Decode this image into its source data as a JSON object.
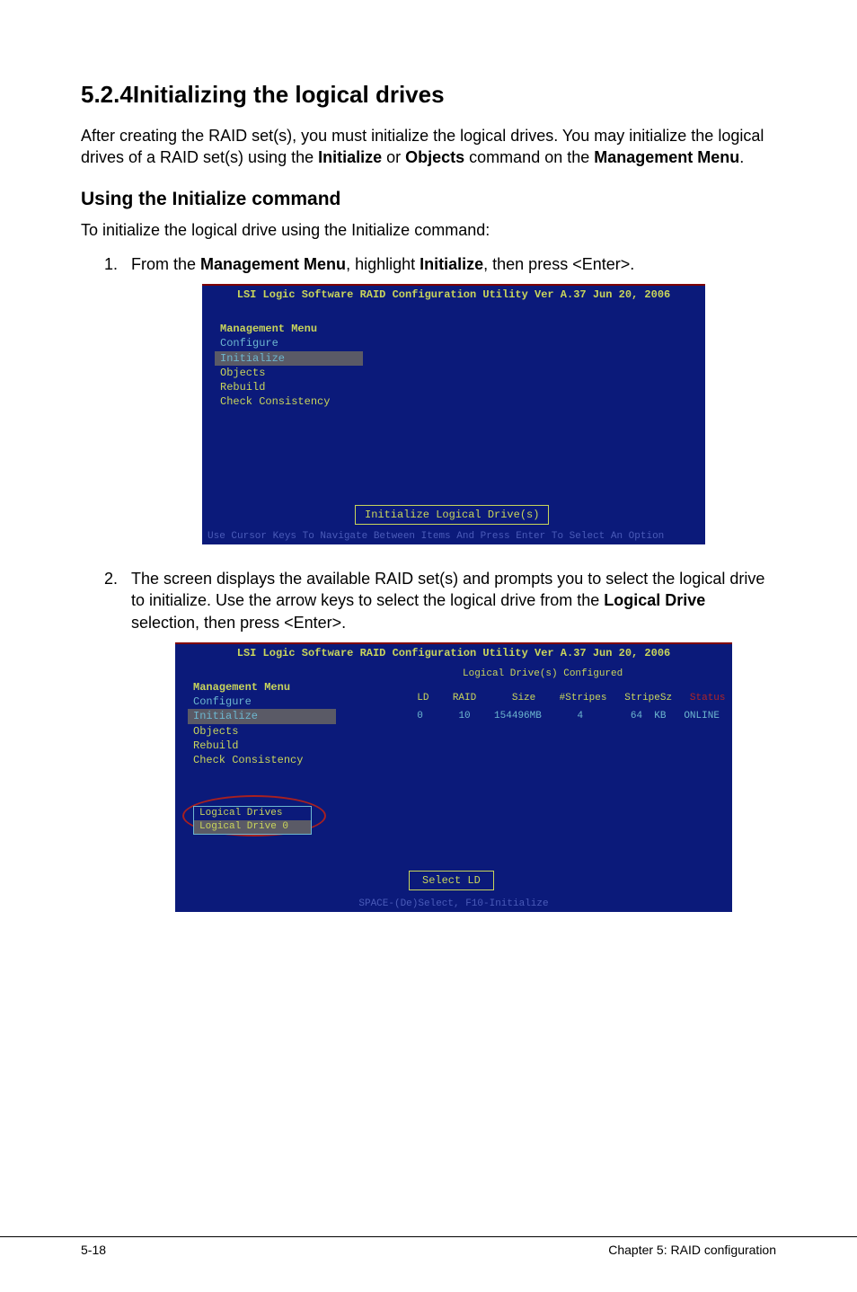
{
  "section": {
    "number": "5.2.4",
    "title": "Initializing the logical drives"
  },
  "intro": {
    "p1_a": "After creating the RAID set(s), you must initialize the logical drives. You may initialize the logical drives of a RAID set(s) using the ",
    "bold1": "Initialize",
    "p1_b": " or ",
    "bold2": "Objects",
    "p1_c": " command on the ",
    "bold3": "Management Menu",
    "p1_d": "."
  },
  "sub1": {
    "heading": "Using the Initialize command",
    "lead": "To initialize the logical drive using the Initialize command:"
  },
  "steps": {
    "s1_a": "From the ",
    "s1_b1": "Management Menu",
    "s1_c": ", highlight ",
    "s1_b2": "Initialize",
    "s1_d": ", then press <Enter>.",
    "s2_a": "The screen displays the available RAID set(s) and prompts you to select the logical drive to initialize. Use the arrow keys to select the logical drive from the ",
    "s2_b1": "Logical Drive",
    "s2_c": " selection, then press <Enter>."
  },
  "bios": {
    "title": "LSI Logic Software RAID Configuration Utility Ver A.37 Jun 20, 2006",
    "menu_label": "Management Menu",
    "menu": {
      "configure": "Configure",
      "initialize": "Initialize",
      "objects": "Objects",
      "rebuild": "Rebuild",
      "check": "Check Consistency"
    },
    "init_box": "Initialize Logical Drive(s)",
    "footer1": "Use Cursor Keys To Navigate Between Items And Press Enter To Select An Option",
    "config_label": "Logical Drive(s) Configured",
    "headers": {
      "ld": "LD",
      "raid": "RAID",
      "size": "Size",
      "stripes": "#Stripes",
      "stripesz": "StripeSz",
      "status": "Status"
    },
    "row": {
      "ld": "0",
      "raid": "10",
      "size": "154496MB",
      "stripes": "4",
      "stripesz": "64  KB",
      "status": "ONLINE"
    },
    "ld_box_header": "Logical Drives",
    "ld_box_item": "Logical Drive 0",
    "select_ld": "Select LD",
    "footer2": "SPACE-(De)Select,  F10-Initialize"
  },
  "footer": {
    "left": "5-18",
    "right": "Chapter 5: RAID configuration"
  }
}
